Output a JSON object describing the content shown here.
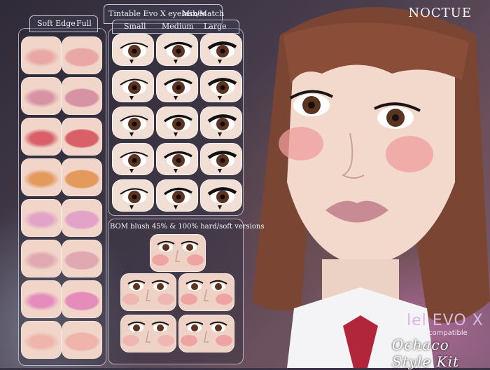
{
  "brand": {
    "logo": "NOCTUE"
  },
  "lips_panel": {
    "tabs": [
      "Soft Edge",
      "Full"
    ],
    "shades": [
      {
        "name": "nude-pink",
        "color": "#e9a8a6"
      },
      {
        "name": "mauve",
        "color": "#d792a4"
      },
      {
        "name": "coral-red",
        "color": "#d96068"
      },
      {
        "name": "peach",
        "color": "#e39a5c"
      },
      {
        "name": "light-pink",
        "color": "#e3a3c9"
      },
      {
        "name": "dusty-rose",
        "color": "#e0a8b0"
      },
      {
        "name": "bubblegum",
        "color": "#e58cbc"
      },
      {
        "name": "soft-peach",
        "color": "#efb4ab"
      }
    ]
  },
  "eyelashes_panel": {
    "title": "Tintable Evo X eyelashes",
    "subtitle": "Mix/Match",
    "columns": [
      "Small",
      "Medium",
      "Large"
    ],
    "rows": 5
  },
  "blush_panel": {
    "title": "BOM blush 45% & 100%  hard/soft versions",
    "tiles": 5
  },
  "product": {
    "compat_name": "lel EVO X",
    "compat_label": "compatible",
    "kit_name": "Ochaco Style Kit"
  },
  "colors": {
    "accent_text": "#d8b6e7",
    "panel_border": "#dde1f0",
    "iris": "#5b3421",
    "hair": "#7a4633",
    "skin": "#f2d9cc"
  }
}
